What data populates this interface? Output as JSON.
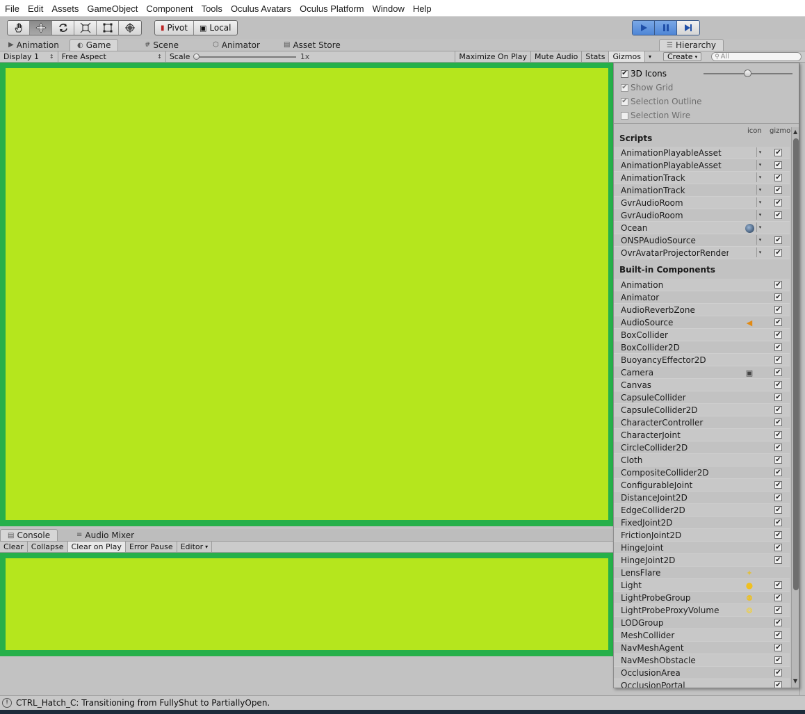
{
  "menu": [
    "File",
    "Edit",
    "Assets",
    "GameObject",
    "Component",
    "Tools",
    "Oculus Avatars",
    "Oculus Platform",
    "Window",
    "Help"
  ],
  "toolbar": {
    "tools": [
      "hand-tool-icon",
      "move-tool-icon",
      "rotate-tool-icon",
      "scale-tool-icon",
      "rect-tool-icon",
      "transform-tool-icon"
    ],
    "pivot_label": "Pivot",
    "local_label": "Local",
    "play_icons": [
      "play-icon",
      "pause-icon",
      "step-icon"
    ]
  },
  "main_tabs": [
    {
      "label": "Animation",
      "icon": "animation-icon"
    },
    {
      "label": "Game",
      "icon": "game-icon"
    },
    {
      "label": "Scene",
      "icon": "scene-icon"
    },
    {
      "label": "Animator",
      "icon": "animator-icon"
    },
    {
      "label": "Asset Store",
      "icon": "store-icon"
    }
  ],
  "game_toolbar": {
    "display": "Display 1",
    "aspect": "Free Aspect",
    "scale_label": "Scale",
    "scale_value": "1x",
    "maximize": "Maximize On Play",
    "mute": "Mute Audio",
    "stats": "Stats",
    "gizmos": "Gizmos"
  },
  "hierarchy": {
    "tab_label": "Hierarchy",
    "create_label": "Create",
    "search_placeholder": "All"
  },
  "gizmos_panel": {
    "options": [
      {
        "label": "3D Icons",
        "checked": true,
        "enabled": true
      },
      {
        "label": "Show Grid",
        "checked": true,
        "enabled": false
      },
      {
        "label": "Selection Outline",
        "checked": true,
        "enabled": false
      },
      {
        "label": "Selection Wire",
        "checked": false,
        "enabled": false
      }
    ],
    "icon_col": "icon",
    "gizmo_col": "gizmo",
    "scripts_heading": "Scripts",
    "scripts": [
      {
        "name": "AnimationPlayableAsset",
        "icon": "",
        "dropdown": true,
        "gizmo": true
      },
      {
        "name": "AnimationPlayableAsset",
        "icon": "",
        "dropdown": true,
        "gizmo": true
      },
      {
        "name": "AnimationTrack",
        "icon": "",
        "dropdown": true,
        "gizmo": true
      },
      {
        "name": "AnimationTrack",
        "icon": "",
        "dropdown": true,
        "gizmo": true
      },
      {
        "name": "GvrAudioRoom",
        "icon": "",
        "dropdown": true,
        "gizmo": true
      },
      {
        "name": "GvrAudioRoom",
        "icon": "",
        "dropdown": true,
        "gizmo": true
      },
      {
        "name": "Ocean",
        "icon": "ocean-icon",
        "dropdown": true,
        "gizmo": null
      },
      {
        "name": "ONSPAudioSource",
        "icon": "",
        "dropdown": true,
        "gizmo": true
      },
      {
        "name": "OvrAvatarProjectorRender",
        "icon": "",
        "dropdown": true,
        "gizmo": true
      }
    ],
    "builtin_heading": "Built-in Components",
    "builtin": [
      {
        "name": "Animation",
        "icon": "",
        "gizmo": true
      },
      {
        "name": "Animator",
        "icon": "",
        "gizmo": true
      },
      {
        "name": "AudioReverbZone",
        "icon": "",
        "gizmo": true
      },
      {
        "name": "AudioSource",
        "icon": "speaker-icon",
        "gizmo": true
      },
      {
        "name": "BoxCollider",
        "icon": "",
        "gizmo": true
      },
      {
        "name": "BoxCollider2D",
        "icon": "",
        "gizmo": true
      },
      {
        "name": "BuoyancyEffector2D",
        "icon": "",
        "gizmo": true
      },
      {
        "name": "Camera",
        "icon": "camera-icon",
        "gizmo": true
      },
      {
        "name": "Canvas",
        "icon": "",
        "gizmo": true
      },
      {
        "name": "CapsuleCollider",
        "icon": "",
        "gizmo": true
      },
      {
        "name": "CapsuleCollider2D",
        "icon": "",
        "gizmo": true
      },
      {
        "name": "CharacterController",
        "icon": "",
        "gizmo": true
      },
      {
        "name": "CharacterJoint",
        "icon": "",
        "gizmo": true
      },
      {
        "name": "CircleCollider2D",
        "icon": "",
        "gizmo": true
      },
      {
        "name": "Cloth",
        "icon": "",
        "gizmo": true
      },
      {
        "name": "CompositeCollider2D",
        "icon": "",
        "gizmo": true
      },
      {
        "name": "ConfigurableJoint",
        "icon": "",
        "gizmo": true
      },
      {
        "name": "DistanceJoint2D",
        "icon": "",
        "gizmo": true
      },
      {
        "name": "EdgeCollider2D",
        "icon": "",
        "gizmo": true
      },
      {
        "name": "FixedJoint2D",
        "icon": "",
        "gizmo": true
      },
      {
        "name": "FrictionJoint2D",
        "icon": "",
        "gizmo": true
      },
      {
        "name": "HingeJoint",
        "icon": "",
        "gizmo": true
      },
      {
        "name": "HingeJoint2D",
        "icon": "",
        "gizmo": true
      },
      {
        "name": "LensFlare",
        "icon": "lensflare-icon",
        "gizmo": null
      },
      {
        "name": "Light",
        "icon": "lightbulb-icon",
        "gizmo": true
      },
      {
        "name": "LightProbeGroup",
        "icon": "lightprobe-icon",
        "gizmo": true
      },
      {
        "name": "LightProbeProxyVolume",
        "icon": "proxyvolume-icon",
        "gizmo": true
      },
      {
        "name": "LODGroup",
        "icon": "",
        "gizmo": true
      },
      {
        "name": "MeshCollider",
        "icon": "",
        "gizmo": true
      },
      {
        "name": "NavMeshAgent",
        "icon": "",
        "gizmo": true
      },
      {
        "name": "NavMeshObstacle",
        "icon": "",
        "gizmo": true
      },
      {
        "name": "OcclusionArea",
        "icon": "",
        "gizmo": true
      },
      {
        "name": "OcclusionPortal",
        "icon": "",
        "gizmo": true
      }
    ]
  },
  "console": {
    "tabs": [
      {
        "label": "Console",
        "icon": "console-icon"
      },
      {
        "label": "Audio Mixer",
        "icon": "mixer-icon"
      }
    ],
    "buttons": [
      {
        "label": "Clear",
        "on": false
      },
      {
        "label": "Collapse",
        "on": false
      },
      {
        "label": "Clear on Play",
        "on": true
      },
      {
        "label": "Error Pause",
        "on": false
      },
      {
        "label": "Editor",
        "on": false
      }
    ]
  },
  "status": {
    "message": "CTRL_Hatch_C: Transitioning from FullyShut to PartiallyOpen."
  },
  "colors": {
    "game_border": "#26b04a",
    "game_fill": "#b5e61d",
    "play_active": "#4f86d6"
  }
}
